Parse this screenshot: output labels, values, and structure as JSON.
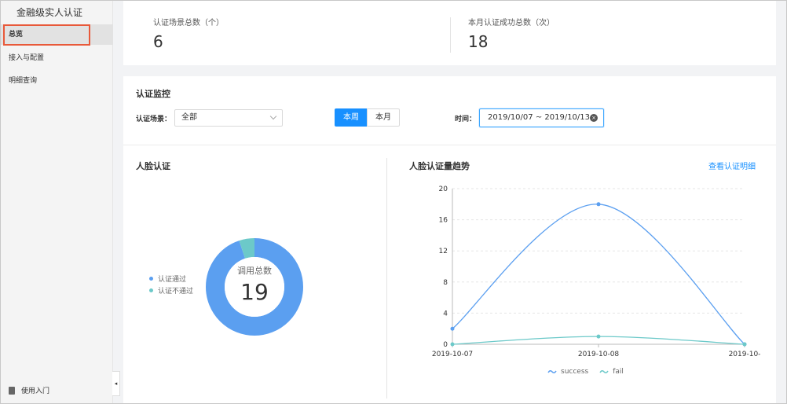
{
  "sidebar": {
    "title": "金融级实人认证",
    "items": [
      {
        "label": "总览"
      },
      {
        "label": "接入与配置"
      },
      {
        "label": "明细查询"
      }
    ],
    "footer": "使用入门",
    "collapse_glyph": "◂"
  },
  "stats": {
    "scene_total_label": "认证场景总数（个）",
    "scene_total_value": "6",
    "month_success_label": "本月认证成功总数（次）",
    "month_success_value": "18"
  },
  "monitor": {
    "title": "认证监控",
    "scene_label": "认证场景：",
    "scene_value": "全部",
    "week_label": "本周",
    "month_label": "本月",
    "time_label": "时间：",
    "date_range": "2019/10/07 ~ 2019/10/13",
    "clear_glyph": "×"
  },
  "face": {
    "title": "人脸认证",
    "legend_pass": "认证通过",
    "legend_fail": "认证不通过",
    "center_label": "调用总数",
    "center_value": "19"
  },
  "trend": {
    "title": "人脸认证量趋势",
    "link": "查看认证明细"
  },
  "colors": {
    "blue": "#5b9ff0",
    "teal": "#6cc9c9",
    "primary": "#1890ff",
    "highlight": "#e8593a"
  },
  "chart_data": [
    {
      "type": "pie",
      "labels": [
        "认证通过",
        "认证不通过"
      ],
      "values": [
        18,
        1
      ],
      "total_label": "调用总数",
      "total": 19
    },
    {
      "type": "line",
      "x": [
        "2019-10-07",
        "2019-10-08",
        "2019-10-"
      ],
      "series": [
        {
          "name": "success",
          "values": [
            2,
            18,
            0
          ]
        },
        {
          "name": "fail",
          "values": [
            0,
            1,
            0
          ]
        }
      ],
      "yticks": [
        0,
        4,
        8,
        12,
        16,
        20
      ],
      "ylim": [
        0,
        20
      ],
      "grid": true,
      "legend": "bottom"
    }
  ]
}
